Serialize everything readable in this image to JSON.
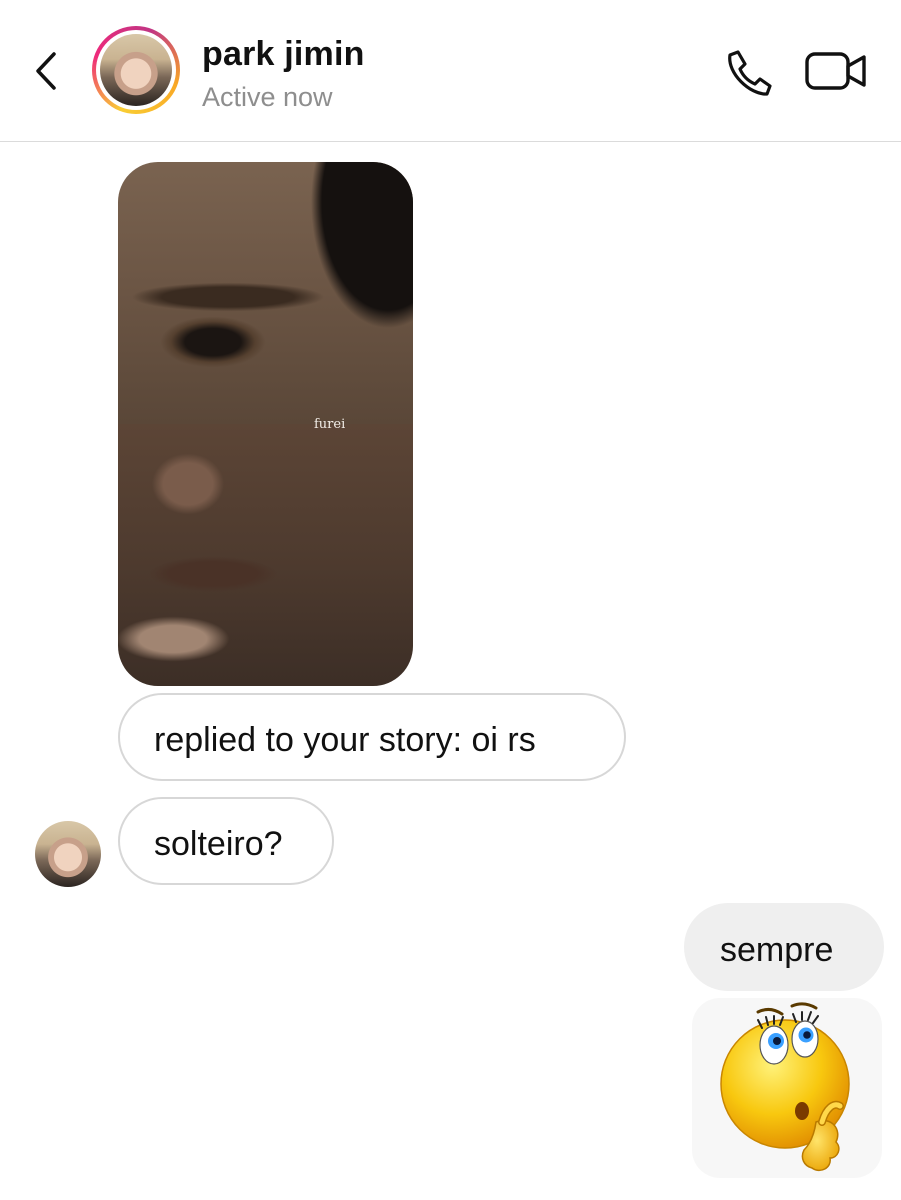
{
  "header": {
    "title": "park jimin",
    "status": "Active now",
    "back_icon": "chevron-left-icon",
    "call_icon": "phone-icon",
    "video_icon": "video-camera-icon"
  },
  "story": {
    "caption": "furei"
  },
  "messages": {
    "reply": "replied to your story: oi rs",
    "question": "solteiro?",
    "outgoing": "sempre"
  },
  "sticker": {
    "icon": "thinking-emoji-icon"
  },
  "colors": {
    "status_text": "#8e8e8e",
    "incoming_border": "#d7d7d7",
    "outgoing_bubble": "#efefef",
    "story_ring_start": "#f9ce34",
    "story_ring_end": "#ee2a7b"
  }
}
